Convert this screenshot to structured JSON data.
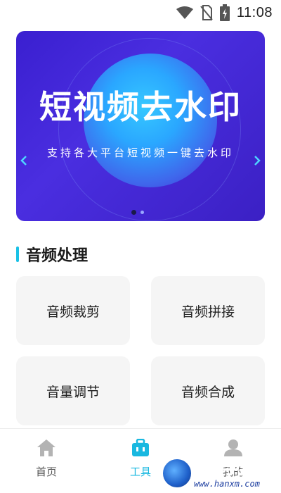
{
  "status_bar": {
    "time": "11:08",
    "icons": [
      "wifi-icon",
      "no-sim-icon",
      "battery-charging-icon"
    ]
  },
  "banner": {
    "title": "短视频去水印",
    "subtitle": "支持各大平台短视频一键去水印",
    "page_count": 2,
    "active_page": 1
  },
  "section": {
    "title": "音频处理",
    "accent_color": "#19c1e6"
  },
  "tiles": [
    {
      "label": "音频裁剪"
    },
    {
      "label": "音频拼接"
    },
    {
      "label": "音量调节"
    },
    {
      "label": "音频合成"
    }
  ],
  "bottom_nav": {
    "items": [
      {
        "label": "首页",
        "icon": "home-icon",
        "active": false
      },
      {
        "label": "工具",
        "icon": "toolbox-icon",
        "active": true
      },
      {
        "label": "我的",
        "icon": "user-icon",
        "active": false
      }
    ],
    "active_color": "#19b8e0"
  },
  "watermark": {
    "text": "西美手游网",
    "url": "www.hanxm.com"
  }
}
